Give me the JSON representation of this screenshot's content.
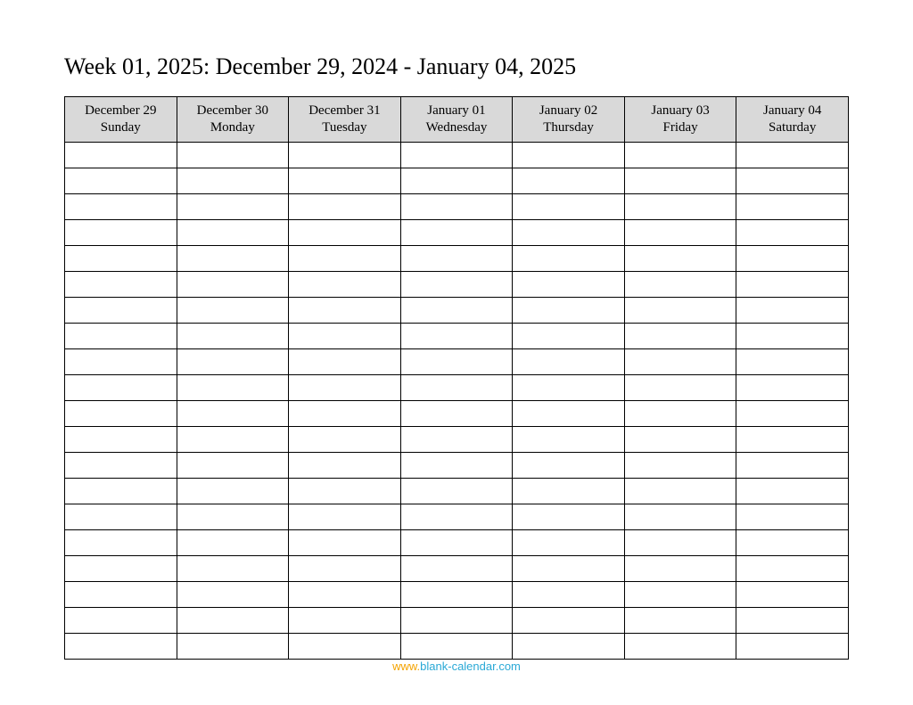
{
  "title": "Week 01, 2025: December 29, 2024 - January 04, 2025",
  "days": [
    {
      "date": "December 29",
      "dow": "Sunday"
    },
    {
      "date": "December 30",
      "dow": "Monday"
    },
    {
      "date": "December 31",
      "dow": "Tuesday"
    },
    {
      "date": "January 01",
      "dow": "Wednesday"
    },
    {
      "date": "January 02",
      "dow": "Thursday"
    },
    {
      "date": "January 03",
      "dow": "Friday"
    },
    {
      "date": "January 04",
      "dow": "Saturday"
    }
  ],
  "row_count": 20,
  "footer": {
    "prefix": "www.",
    "domain": "blank-calendar.com"
  }
}
